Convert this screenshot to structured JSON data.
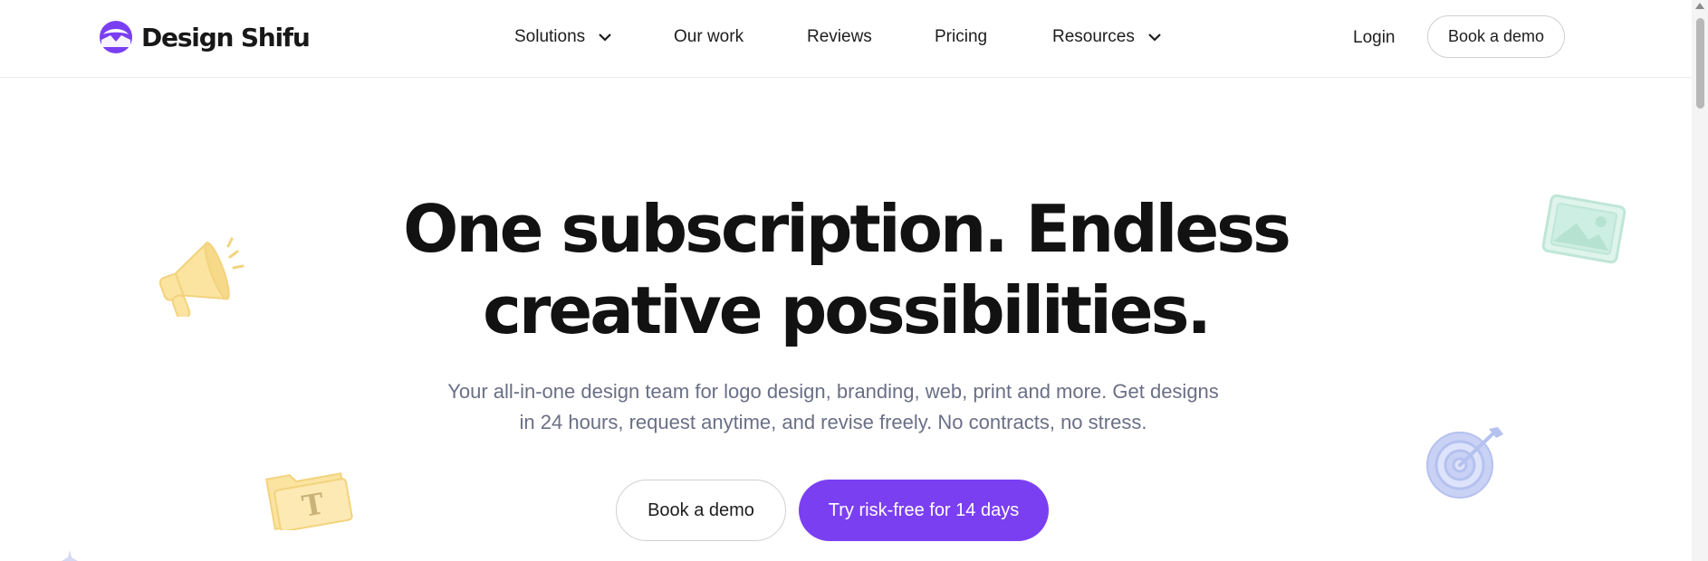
{
  "header": {
    "brand": "Design Shifu",
    "nav": [
      {
        "label": "Solutions",
        "has_dropdown": true
      },
      {
        "label": "Our work",
        "has_dropdown": false
      },
      {
        "label": "Reviews",
        "has_dropdown": false
      },
      {
        "label": "Pricing",
        "has_dropdown": false
      },
      {
        "label": "Resources",
        "has_dropdown": true
      }
    ],
    "login_label": "Login",
    "book_demo_label": "Book a demo"
  },
  "hero": {
    "title_line1": "One subscription. Endless",
    "title_line2": "creative possibilities.",
    "subtitle_line1": "Your all-in-one design team for logo design, branding, web, print and more. Get designs",
    "subtitle_line2": "in 24 hours, request anytime, and revise freely. No contracts, no stress.",
    "cta_secondary": "Book a demo",
    "cta_primary": "Try risk-free for 14 days",
    "deco_folder_letter": "T"
  },
  "icons": [
    "megaphone-icon",
    "folder-icon",
    "image-icon",
    "target-icon",
    "chevron-down-icon"
  ],
  "colors": {
    "brand_purple": "#7b3ff2",
    "subtitle_gray": "#6a6f86",
    "deco_yellow": "#fbe3a0",
    "deco_green": "#cdeee2",
    "deco_blue": "#c9d2f5"
  }
}
